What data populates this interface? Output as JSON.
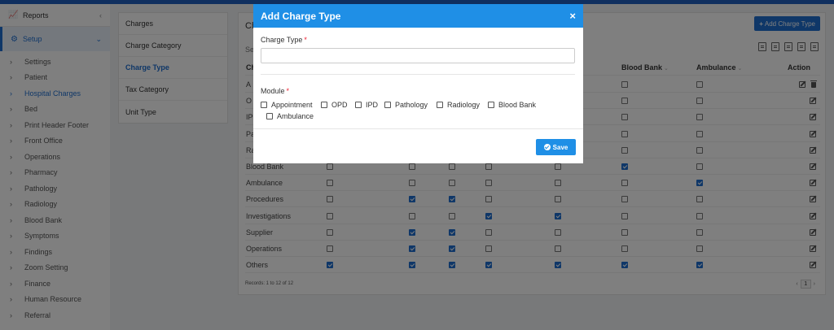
{
  "sidebar": {
    "reports_label": "Reports",
    "setup_label": "Setup",
    "items": [
      {
        "label": "Settings"
      },
      {
        "label": "Patient"
      },
      {
        "label": "Hospital Charges"
      },
      {
        "label": "Bed"
      },
      {
        "label": "Print Header Footer"
      },
      {
        "label": "Front Office"
      },
      {
        "label": "Operations"
      },
      {
        "label": "Pharmacy"
      },
      {
        "label": "Pathology"
      },
      {
        "label": "Radiology"
      },
      {
        "label": "Blood Bank"
      },
      {
        "label": "Symptoms"
      },
      {
        "label": "Findings"
      },
      {
        "label": "Zoom Setting"
      },
      {
        "label": "Finance"
      },
      {
        "label": "Human Resource"
      },
      {
        "label": "Referral"
      }
    ],
    "active_item": "Hospital Charges"
  },
  "submenu": {
    "items": [
      {
        "label": "Charges"
      },
      {
        "label": "Charge Category"
      },
      {
        "label": "Charge Type"
      },
      {
        "label": "Tax Category"
      },
      {
        "label": "Unit Type"
      }
    ],
    "active_item": "Charge Type"
  },
  "panel": {
    "title": "Ch",
    "add_button_label": "Add Charge Type",
    "search_hint": "Se",
    "columns": {
      "charge_type": "Ch",
      "blood_bank": "Blood Bank",
      "ambulance": "Ambulance",
      "action": "Action"
    },
    "rows": [
      {
        "name": "A",
        "checks": [
          false,
          false,
          false,
          false,
          false,
          false,
          false
        ]
      },
      {
        "name": "O",
        "checks": [
          false,
          false,
          false,
          false,
          false,
          false,
          false
        ]
      },
      {
        "name": "IP",
        "checks": [
          false,
          false,
          false,
          false,
          false,
          false,
          false
        ]
      },
      {
        "name": "Pa",
        "checks": [
          false,
          false,
          false,
          false,
          false,
          false,
          false
        ]
      },
      {
        "name": "Ra",
        "checks": [
          false,
          false,
          false,
          false,
          false,
          false,
          false
        ]
      },
      {
        "name": "Blood Bank",
        "checks": [
          false,
          false,
          false,
          false,
          false,
          true,
          false
        ]
      },
      {
        "name": "Ambulance",
        "checks": [
          false,
          false,
          false,
          false,
          false,
          false,
          true
        ]
      },
      {
        "name": "Procedures",
        "checks": [
          false,
          true,
          true,
          false,
          false,
          false,
          false
        ]
      },
      {
        "name": "Investigations",
        "checks": [
          false,
          false,
          false,
          true,
          true,
          false,
          false
        ]
      },
      {
        "name": "Supplier",
        "checks": [
          false,
          true,
          true,
          false,
          false,
          false,
          false
        ]
      },
      {
        "name": "Operations",
        "checks": [
          false,
          true,
          true,
          false,
          false,
          false,
          false
        ]
      },
      {
        "name": "Others",
        "checks": [
          true,
          true,
          true,
          true,
          true,
          true,
          true
        ]
      }
    ],
    "records_text": "Records: 1 to 12 of 12",
    "pager": {
      "prev": "‹",
      "page": "1",
      "next": "›"
    }
  },
  "modal": {
    "title": "Add Charge Type",
    "close_symbol": "×",
    "charge_type_label": "Charge Type",
    "required_marker": "*",
    "charge_type_value": "",
    "module_label": "Module",
    "modules": [
      {
        "label": "Appointment"
      },
      {
        "label": "OPD"
      },
      {
        "label": "IPD"
      },
      {
        "label": "Pathology"
      },
      {
        "label": "Radiology"
      },
      {
        "label": "Blood Bank"
      },
      {
        "label": "Ambulance"
      }
    ],
    "save_label": "Save"
  },
  "colors": {
    "accent": "#1f6fd0",
    "modal_header": "#1f8fe6",
    "overlay": "rgba(0,0,0,0.5)"
  }
}
